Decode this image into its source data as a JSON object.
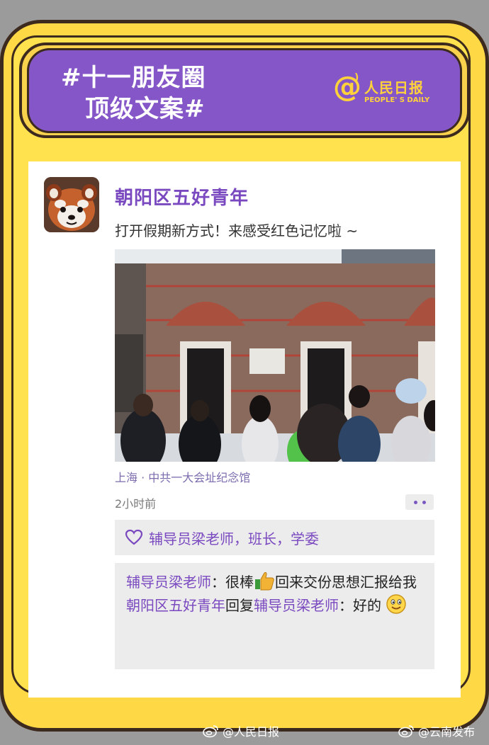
{
  "header": {
    "line1": "#十一朋友圈",
    "line2": "顶级文案#",
    "brand_name": "人民日报",
    "brand_sub": "PEOPLE' S DAILY",
    "brand_at": "@"
  },
  "post": {
    "poster_name": "朝阳区五好青年",
    "text": "打开假期新方式！来感受红色记忆啦 ~",
    "location": "上海 · 中共一大会址纪念馆",
    "time": "2小时前"
  },
  "likes": {
    "icon": "heart-icon",
    "names": "辅导员梁老师，班长，学委"
  },
  "comments": [
    {
      "user": "辅导员梁老师",
      "sep": "：",
      "text_before": "很棒",
      "emoji": "thumbs-up-icon",
      "text_after": "回来交份思想汇报给我"
    },
    {
      "user": "朝阳区五好青年",
      "reply_word": "回复",
      "reply_to": "辅导员梁老师",
      "sep": "：",
      "text": "好的",
      "emoji": "smile-emoji-icon"
    }
  ],
  "watermarks": [
    {
      "icon": "weibo-icon",
      "text": "@人民日报"
    },
    {
      "icon": "weibo-icon",
      "text": "@云南发布"
    }
  ],
  "colors": {
    "accent_purple": "#7a49c0",
    "header_purple": "#8456c7",
    "frame_yellow": "#ffd945",
    "brand_yellow": "#ffd23b"
  }
}
